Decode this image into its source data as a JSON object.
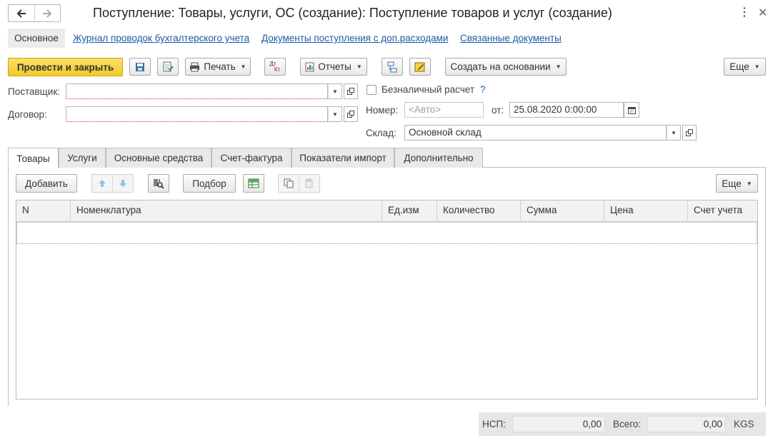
{
  "window": {
    "title": "Поступление: Товары, услуги, ОС (создание): Поступление товаров и услуг (создание)"
  },
  "nav": {
    "main": "Основное",
    "links": [
      "Журнал проводок бухгалтерского учета",
      "Документы поступления с доп.расходами",
      "Связанные документы"
    ]
  },
  "toolbar": {
    "post_close": "Провести и закрыть",
    "print": "Печать",
    "reports": "Отчеты",
    "create_based": "Создать на основании",
    "more": "Еще",
    "dtkt_top": "Дт",
    "dtkt_bottom": "Кт"
  },
  "form": {
    "supplier_label": "Поставщик:",
    "supplier_value": "",
    "contract_label": "Договор:",
    "contract_value": "",
    "cashless_label": "Безналичный расчет",
    "help": "?",
    "number_label": "Номер:",
    "number_placeholder": "<Авто>",
    "date_label": "от:",
    "date_value": "25.08.2020  0:00:00",
    "warehouse_label": "Склад:",
    "warehouse_value": "Основной склад"
  },
  "tabs": [
    "Товары",
    "Услуги",
    "Основные средства",
    "Счет-фактура",
    "Показатели импорт",
    "Дополнительно"
  ],
  "table_toolbar": {
    "add": "Добавить",
    "pick": "Подбор",
    "more": "Еще"
  },
  "table": {
    "columns": [
      "N",
      "Номенклатура",
      "Ед.изм",
      "Количество",
      "Сумма",
      "Цена",
      "Счет учета"
    ]
  },
  "footer": {
    "nsp_label": "НСП:",
    "nsp_value": "0,00",
    "total_label": "Всего:",
    "total_value": "0,00",
    "currency": "KGS"
  },
  "colors": {
    "accent_yellow": "#f6d33d",
    "link_blue": "#1c5aa6",
    "required_underline": "#d93030"
  }
}
